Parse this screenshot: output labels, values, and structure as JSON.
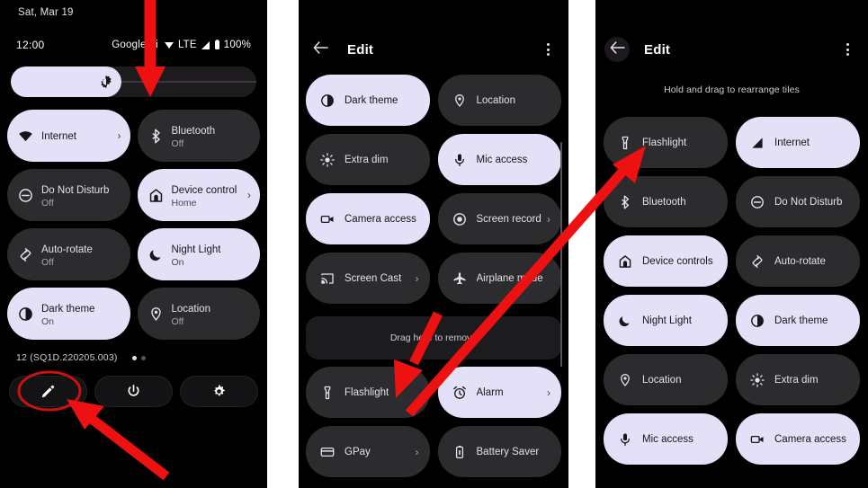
{
  "panels": {
    "quick_settings": {
      "date": "Sat, Mar 19",
      "clock": "12:00",
      "carrier": "Google Fi",
      "network_type": "LTE",
      "battery_percent": "100%",
      "brightness": {
        "icon": "brightness-icon",
        "value_percent": 45
      },
      "tiles": [
        {
          "label": "Internet",
          "sublabel": "",
          "icon": "wifi-icon",
          "state": "on",
          "chevron": true
        },
        {
          "label": "Bluetooth",
          "sublabel": "Off",
          "icon": "bluetooth-icon",
          "state": "off",
          "chevron": false
        },
        {
          "label": "Do Not Disturb",
          "sublabel": "Off",
          "icon": "do-not-disturb-icon",
          "state": "off",
          "chevron": false
        },
        {
          "label": "Device control",
          "sublabel": "Home",
          "icon": "home-icon",
          "state": "on",
          "chevron": true
        },
        {
          "label": "Auto-rotate",
          "sublabel": "Off",
          "icon": "auto-rotate-icon",
          "state": "off",
          "chevron": false
        },
        {
          "label": "Night Light",
          "sublabel": "On",
          "icon": "moon-icon",
          "state": "on",
          "chevron": false
        },
        {
          "label": "Dark theme",
          "sublabel": "On",
          "icon": "dark-theme-icon",
          "state": "on",
          "chevron": false
        },
        {
          "label": "Location",
          "sublabel": "Off",
          "icon": "location-pin-icon",
          "state": "off",
          "chevron": false
        }
      ],
      "build_version": "12 (SQ1D.220205.003)",
      "page_dots": {
        "count": 2,
        "active_index": 0
      },
      "footer_buttons": [
        {
          "name": "edit-button",
          "icon": "pencil-icon",
          "highlighted": true
        },
        {
          "name": "power-button",
          "icon": "power-icon",
          "highlighted": false
        },
        {
          "name": "settings-button",
          "icon": "gear-icon",
          "highlighted": false
        }
      ]
    },
    "edit_before": {
      "title": "Edit",
      "back_icon": "arrow-left-icon",
      "menu_icon": "kebab-menu-icon",
      "tiles": [
        {
          "label": "Dark theme",
          "icon": "dark-theme-icon",
          "state": "on",
          "chevron": false
        },
        {
          "label": "Location",
          "icon": "location-pin-icon",
          "state": "off",
          "chevron": false
        },
        {
          "label": "Extra dim",
          "icon": "extra-dim-icon",
          "state": "off",
          "chevron": false
        },
        {
          "label": "Mic access",
          "icon": "microphone-icon",
          "state": "on",
          "chevron": false
        },
        {
          "label": "Camera access",
          "icon": "camera-icon",
          "state": "on",
          "chevron": false
        },
        {
          "label": "Screen record",
          "icon": "screen-record-icon",
          "state": "off",
          "chevron": true
        },
        {
          "label": "Screen Cast",
          "icon": "cast-icon",
          "state": "off",
          "chevron": true
        },
        {
          "label": "Airplane mode",
          "icon": "airplane-icon",
          "state": "off",
          "chevron": false
        }
      ],
      "remove_zone_label": "Drag here to remove",
      "bottom_tiles": [
        {
          "label": "Flashlight",
          "icon": "flashlight-icon",
          "state": "off",
          "chevron": false
        },
        {
          "label": "Alarm",
          "icon": "alarm-clock-icon",
          "state": "on",
          "chevron": true
        },
        {
          "label": "GPay",
          "icon": "credit-card-icon",
          "state": "off",
          "chevron": true
        },
        {
          "label": "Battery Saver",
          "icon": "battery-icon",
          "state": "off",
          "chevron": false
        }
      ]
    },
    "edit_after": {
      "title": "Edit",
      "back_icon": "arrow-left-icon",
      "menu_icon": "kebab-menu-icon",
      "hint": "Hold and drag to rearrange tiles",
      "tiles": [
        {
          "label": "Flashlight",
          "icon": "flashlight-icon",
          "state": "off",
          "chevron": false
        },
        {
          "label": "Internet",
          "icon": "signal-icon",
          "state": "on",
          "chevron": false
        },
        {
          "label": "Bluetooth",
          "icon": "bluetooth-icon",
          "state": "off",
          "chevron": false
        },
        {
          "label": "Do Not Disturb",
          "icon": "do-not-disturb-icon",
          "state": "off",
          "chevron": false
        },
        {
          "label": "Device controls",
          "icon": "home-icon",
          "state": "on",
          "chevron": false
        },
        {
          "label": "Auto-rotate",
          "icon": "auto-rotate-icon",
          "state": "off",
          "chevron": false
        },
        {
          "label": "Night Light",
          "icon": "moon-icon",
          "state": "on",
          "chevron": false
        },
        {
          "label": "Dark theme",
          "icon": "dark-theme-icon",
          "state": "on",
          "chevron": false
        },
        {
          "label": "Location",
          "icon": "location-pin-icon",
          "state": "off",
          "chevron": false
        },
        {
          "label": "Extra dim",
          "icon": "extra-dim-icon",
          "state": "off",
          "chevron": false
        },
        {
          "label": "Mic access",
          "icon": "microphone-icon",
          "state": "on",
          "chevron": false
        },
        {
          "label": "Camera access",
          "icon": "camera-icon",
          "state": "on",
          "chevron": false
        }
      ]
    }
  },
  "annotations": {
    "color": "#ee1111",
    "items": [
      {
        "name": "arrow-to-brightness-slider",
        "kind": "arrow"
      },
      {
        "name": "ellipse-around-edit-button",
        "kind": "ellipse"
      },
      {
        "name": "arrow-to-edit-button",
        "kind": "arrow"
      },
      {
        "name": "arrow-to-flashlight-tile",
        "kind": "arrow"
      },
      {
        "name": "arrow-flashlight-moved",
        "kind": "arrow"
      }
    ]
  }
}
